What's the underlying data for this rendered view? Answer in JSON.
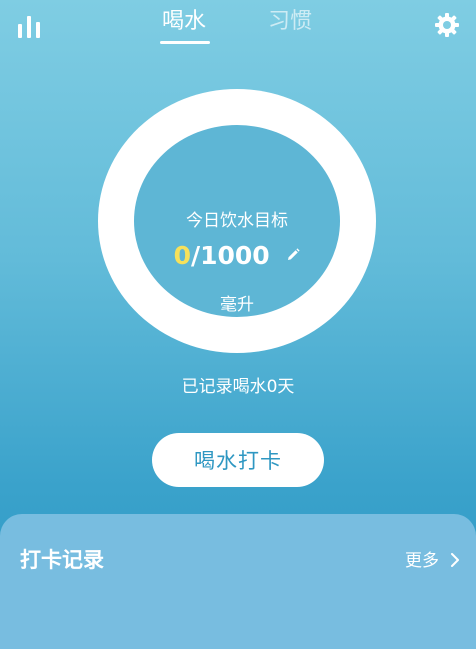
{
  "tabs": {
    "drink": "喝水",
    "habit": "习惯"
  },
  "goal": {
    "label": "今日饮水目标",
    "current": "0",
    "separator_total": "/1000",
    "unit": "毫升"
  },
  "record_days_text": "已记录喝水0天",
  "checkin_button_label": "喝水打卡",
  "records": {
    "title": "打卡记录",
    "more_label": "更多"
  },
  "icons": {
    "stats": "bar-chart-icon",
    "settings": "gear-icon",
    "edit": "pencil-icon",
    "more": "chevron-right-icon"
  },
  "colors": {
    "accent_number": "#f6e15b",
    "button_text": "#2e97c2",
    "panel_bg": "#78bde0"
  }
}
